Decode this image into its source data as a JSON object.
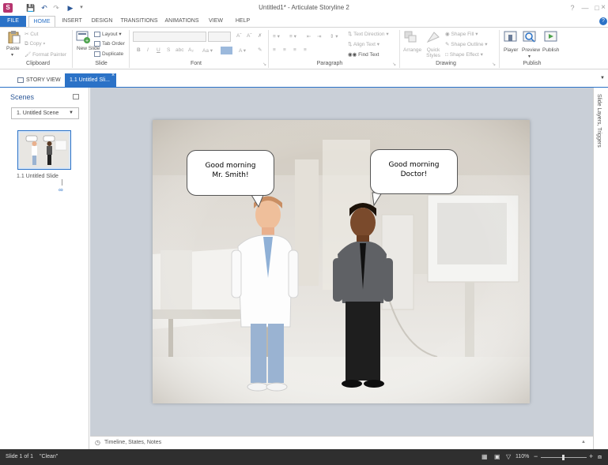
{
  "window": {
    "title": "Untitled1* - Articulate Storyline 2",
    "app_icon_letter": "S"
  },
  "ribbon_tabs": [
    "FILE",
    "HOME",
    "INSERT",
    "DESIGN",
    "TRANSITIONS",
    "ANIMATIONS",
    "VIEW",
    "HELP"
  ],
  "ribbon": {
    "clipboard": {
      "paste": "Paste",
      "cut": "Cut",
      "copy": "Copy",
      "format_painter": "Format Painter",
      "label": "Clipboard"
    },
    "slide": {
      "new_slide": "New Slide",
      "layout": "Layout",
      "tab_order": "Tab Order",
      "duplicate": "Duplicate",
      "label": "Slide"
    },
    "font": {
      "label": "Font"
    },
    "paragraph": {
      "text_direction": "Text Direction",
      "align_text": "Align Text",
      "find_text": "Find Text",
      "label": "Paragraph"
    },
    "drawing": {
      "arrange": "Arrange",
      "quick_styles": "Quick Styles",
      "shape_fill": "Shape Fill",
      "shape_outline": "Shape Outline",
      "shape_effect": "Shape Effect",
      "label": "Drawing"
    },
    "publish": {
      "player": "Player",
      "preview": "Preview",
      "publish": "Publish",
      "label": "Publish"
    }
  },
  "doc_tabs": {
    "story_view": "STORY VIEW",
    "current": "1.1 Untitled Sli..."
  },
  "sidebar": {
    "title": "Scenes",
    "scene_select": "1. Untitled Scene",
    "slide_label": "1.1 Untitled Slide"
  },
  "slide": {
    "bubble_left": [
      "Good morning",
      "Mr. Smith!"
    ],
    "bubble_right": [
      "Good morning",
      "Doctor!"
    ]
  },
  "right_panel": {
    "label": "Slide Layers, Triggers"
  },
  "bottom_panel": {
    "label": "Timeline, States, Notes"
  },
  "status": {
    "slide_info": "Slide 1 of 1",
    "theme": "\"Clean\"",
    "zoom": "110%"
  },
  "colors": {
    "accent": "#2b72c7",
    "status_bar": "#2f2f2f",
    "canvas_bg": "#c9cfd7"
  }
}
